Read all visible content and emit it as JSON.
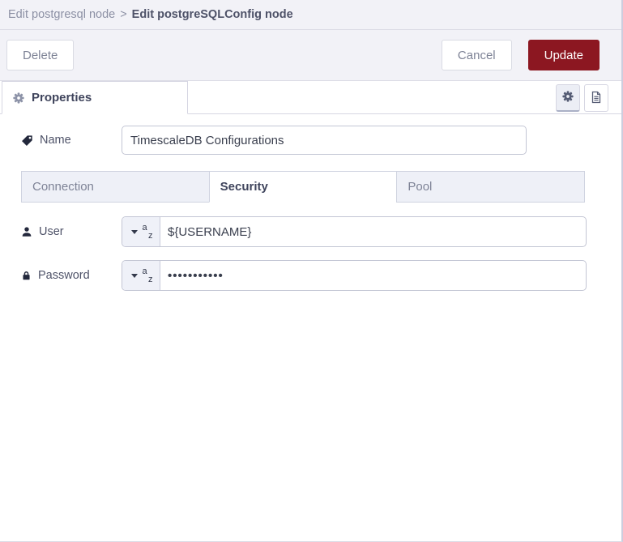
{
  "breadcrumb": {
    "parent": "Edit postgresql node",
    "separator": ">",
    "current": "Edit postgreSQLConfig node"
  },
  "toolbar": {
    "delete_label": "Delete",
    "cancel_label": "Cancel",
    "update_label": "Update"
  },
  "properties_tab": {
    "label": "Properties"
  },
  "panel_icons": [
    {
      "name": "gear-icon",
      "selected": true
    },
    {
      "name": "document-icon",
      "selected": false
    }
  ],
  "form": {
    "name": {
      "label": "Name",
      "icon": "tag-icon",
      "value": "TimescaleDB Configurations"
    },
    "tabs": [
      {
        "label": "Connection",
        "active": false
      },
      {
        "label": "Security",
        "active": true
      },
      {
        "label": "Pool",
        "active": false
      }
    ],
    "user": {
      "label": "User",
      "icon": "user-icon",
      "type": "string",
      "value": "${USERNAME}"
    },
    "password": {
      "label": "Password",
      "icon": "lock-icon",
      "type": "string",
      "value": "•••••••••••"
    }
  },
  "typed_input": {
    "letter_a": "a",
    "letter_z": "z"
  },
  "colors": {
    "header_bg": "#f2f2f7",
    "border": "#d6d6e2",
    "accent_red": "#8c1721",
    "inactive_tab_bg": "#eef0f7",
    "active_text": "#3f445c",
    "muted_text": "#7e8396"
  }
}
